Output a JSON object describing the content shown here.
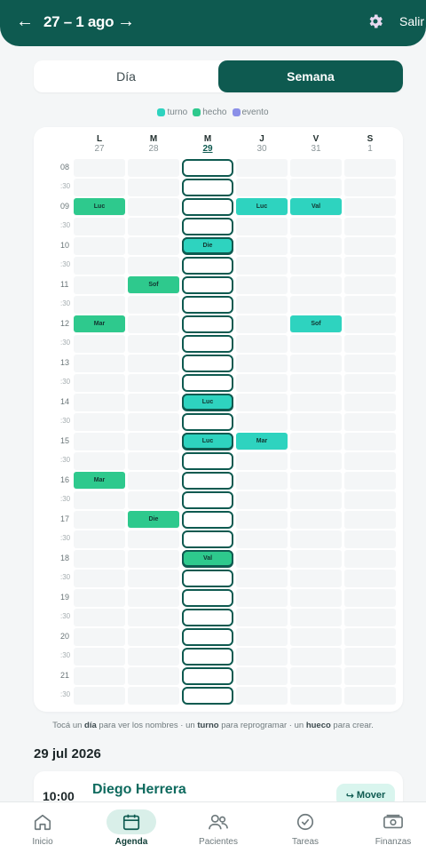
{
  "header": {
    "prev_arrow": "←",
    "title": "27 – 1 ago",
    "next_arrow": "→",
    "logout_label": "Salir"
  },
  "view_toggle": {
    "day_label": "Día",
    "week_label": "Semana",
    "active": "Semana"
  },
  "legend": [
    {
      "label": "turno",
      "color": "#2ed3bf"
    },
    {
      "label": "hecho",
      "color": "#2ec98d"
    },
    {
      "label": "evento",
      "color": "#8b90e8"
    }
  ],
  "week": {
    "days": [
      {
        "letter": "L",
        "num": "27",
        "today": false
      },
      {
        "letter": "M",
        "num": "28",
        "today": false
      },
      {
        "letter": "M",
        "num": "29",
        "today": true
      },
      {
        "letter": "J",
        "num": "30",
        "today": false
      },
      {
        "letter": "V",
        "num": "31",
        "today": false
      },
      {
        "letter": "S",
        "num": "1",
        "today": false
      }
    ],
    "times": [
      "08",
      ":30",
      "09",
      ":30",
      "10",
      ":30",
      "11",
      ":30",
      "12",
      ":30",
      "13",
      ":30",
      "14",
      ":30",
      "15",
      ":30",
      "16",
      ":30",
      "17",
      ":30",
      "18",
      ":30",
      "19",
      ":30",
      "20",
      ":30",
      "21",
      ":30"
    ],
    "open_day_index": 2,
    "appointments": [
      {
        "day": 0,
        "slot": 2,
        "label": "Luc",
        "kind": "hecho"
      },
      {
        "day": 0,
        "slot": 8,
        "label": "Mar",
        "kind": "hecho"
      },
      {
        "day": 0,
        "slot": 16,
        "label": "Mar",
        "kind": "hecho"
      },
      {
        "day": 1,
        "slot": 6,
        "label": "Sof",
        "kind": "hecho"
      },
      {
        "day": 1,
        "slot": 18,
        "label": "Die",
        "kind": "hecho"
      },
      {
        "day": 2,
        "slot": 4,
        "label": "Die",
        "kind": "turno"
      },
      {
        "day": 2,
        "slot": 12,
        "label": "Luc",
        "kind": "turno"
      },
      {
        "day": 2,
        "slot": 14,
        "label": "Luc",
        "kind": "turno"
      },
      {
        "day": 2,
        "slot": 20,
        "label": "Val",
        "kind": "hecho"
      },
      {
        "day": 3,
        "slot": 2,
        "label": "Luc",
        "kind": "turno"
      },
      {
        "day": 3,
        "slot": 14,
        "label": "Mar",
        "kind": "turno"
      },
      {
        "day": 4,
        "slot": 2,
        "label": "Val",
        "kind": "turno"
      },
      {
        "day": 4,
        "slot": 8,
        "label": "Sof",
        "kind": "turno"
      }
    ]
  },
  "hint": {
    "p1": "Tocá un ",
    "b1": "día",
    "p2": " para ver los nombres · un ",
    "b2": "turno",
    "p3": " para reprogramar · un ",
    "b3": "hueco",
    "p4": " para crear."
  },
  "day_detail": {
    "date_title": "29 jul 2026",
    "appointment": {
      "time": "10:00",
      "patient": "Diego Herrera",
      "move_label": "Mover",
      "move_icon": "↪"
    }
  },
  "nav": [
    {
      "label": "Inicio",
      "icon": "home-icon",
      "active": false
    },
    {
      "label": "Agenda",
      "icon": "calendar-icon",
      "active": true
    },
    {
      "label": "Pacientes",
      "icon": "users-icon",
      "active": false
    },
    {
      "label": "Tareas",
      "icon": "check-circle-icon",
      "active": false
    },
    {
      "label": "Finanzas",
      "icon": "cash-icon",
      "active": false
    }
  ]
}
